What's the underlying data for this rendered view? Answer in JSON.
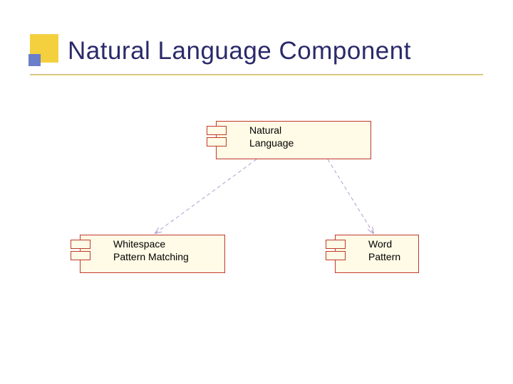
{
  "slide": {
    "title": "Natural Language Component"
  },
  "components": {
    "top": {
      "label": "Natural\nLanguage"
    },
    "left": {
      "label": "Whitespace\nPattern Matching"
    },
    "right": {
      "label": "Word\nPattern"
    }
  }
}
